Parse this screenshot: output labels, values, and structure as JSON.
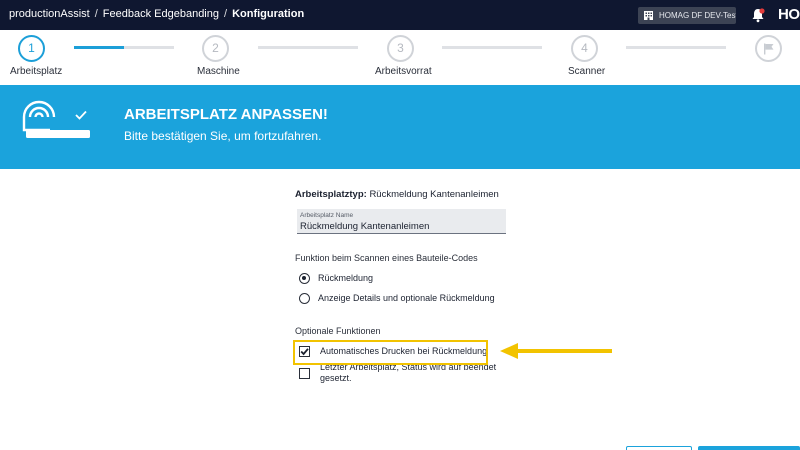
{
  "breadcrumb": {
    "app": "productionAssist",
    "parent": "Feedback Edgebanding",
    "current": "Konfiguration",
    "separator": "/"
  },
  "header": {
    "tenant": "HOMAG DF DEV-Testing",
    "brand": "HO"
  },
  "stepper": {
    "steps": [
      {
        "number": "1",
        "label": "Arbeitsplatz",
        "active": true
      },
      {
        "number": "2",
        "label": "Maschine",
        "active": false
      },
      {
        "number": "3",
        "label": "Arbeitsvorrat",
        "active": false
      },
      {
        "number": "4",
        "label": "Scanner",
        "active": false
      }
    ],
    "first_segment_progress": 0.5,
    "finish_icon": "flag-icon"
  },
  "hero": {
    "title": "ARBEITSPLATZ ANPASSEN!",
    "subtitle": "Bitte bestätigen Sie, um fortzufahren.",
    "accent": "#1ba3dc"
  },
  "form": {
    "type_label": "Arbeitsplatztyp:",
    "type_value": "Rückmeldung Kantenanleimen",
    "name_field": {
      "label": "Arbeitsplatz Name",
      "value": "Rückmeldung Kantenanleimen"
    },
    "scan_section": {
      "title": "Funktion beim Scannen eines Bauteile-Codes",
      "options": [
        {
          "label": "Rückmeldung",
          "checked": true
        },
        {
          "label": "Anzeige Details und optionale Rückmeldung",
          "checked": false
        }
      ]
    },
    "optional_section": {
      "title": "Optionale Funktionen",
      "options": [
        {
          "label": "Automatisches Drucken bei Rückmeldung",
          "checked": true
        },
        {
          "label": "Letzter Arbeitsplatz, Status wird auf beendet gesetzt.",
          "checked": false
        }
      ]
    }
  },
  "annotation": {
    "highlight_color": "#f2c300"
  }
}
